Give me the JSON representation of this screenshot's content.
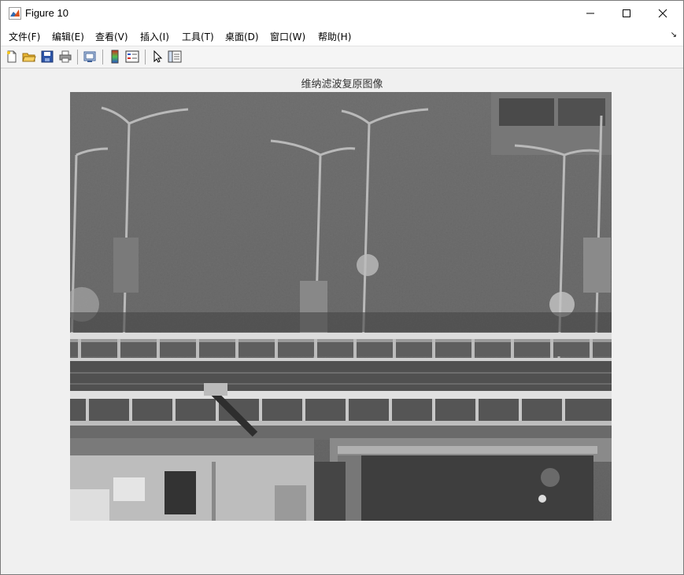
{
  "window": {
    "title": "Figure 10",
    "minimize_icon": "minimize-icon",
    "maximize_icon": "maximize-icon",
    "close_icon": "close-icon"
  },
  "menu": {
    "items": [
      "文件(F)",
      "编辑(E)",
      "查看(V)",
      "插入(I)",
      "工具(T)",
      "桌面(D)",
      "窗口(W)",
      "帮助(H)"
    ]
  },
  "toolbar": {
    "buttons": [
      "new-figure-icon",
      "open-file-icon",
      "save-icon",
      "print-icon",
      "print-preview-icon",
      "colorbar-icon",
      "legend-icon",
      "select-pointer-icon",
      "property-inspector-icon"
    ]
  },
  "figure": {
    "title": "维纳滤波复原图像"
  }
}
